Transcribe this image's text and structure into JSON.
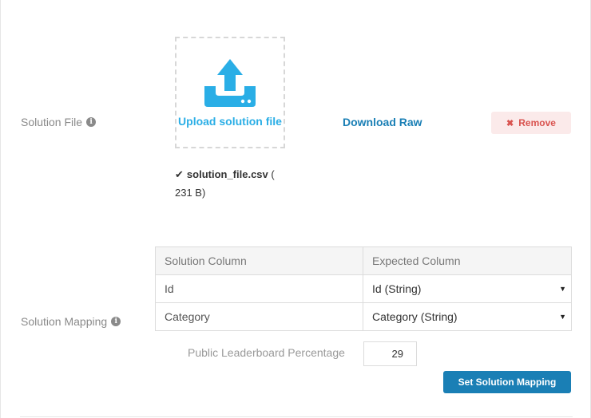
{
  "solution_file": {
    "label": "Solution File",
    "info_icon": "info-circle-icon",
    "upload_label": "Upload solution file",
    "upload_icon": "upload-icon",
    "download_raw": "Download Raw",
    "remove_label": "Remove",
    "remove_icon": "close-icon",
    "file_name": "solution_file.csv",
    "file_size": "( 231 B)",
    "check_icon": "checkmark-icon"
  },
  "solution_mapping": {
    "label": "Solution Mapping",
    "info_icon": "info-circle-icon",
    "headers": [
      "Solution Column",
      "Expected Column"
    ],
    "rows": [
      {
        "solution": "Id",
        "expected": "Id (String)"
      },
      {
        "solution": "Category",
        "expected": "Category (String)"
      }
    ],
    "percentage_label": "Public Leaderboard Percentage",
    "percentage_value": "29",
    "set_button": "Set Solution Mapping"
  },
  "colors": {
    "accent": "#1a7fb5",
    "upload_blue": "#2aaee6",
    "remove_red": "#d9534f",
    "remove_bg": "#fbeaea"
  }
}
